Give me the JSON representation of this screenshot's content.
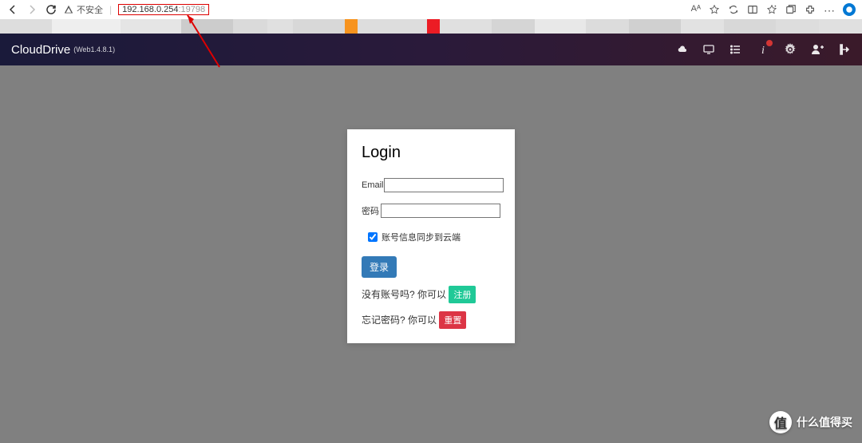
{
  "browser": {
    "insecure_label": "不安全",
    "url_ip": "192.168.0.254",
    "url_port": ":19798",
    "ai_label": "Aᴬ"
  },
  "color_strip": [
    {
      "w": "6%",
      "c": "#ddd"
    },
    {
      "w": "8%",
      "c": "#eee"
    },
    {
      "w": "7%",
      "c": "#e5e5e5"
    },
    {
      "w": "6%",
      "c": "#ccc"
    },
    {
      "w": "4%",
      "c": "#dadada"
    },
    {
      "w": "3%",
      "c": "#e0e0e0"
    },
    {
      "w": "6%",
      "c": "#d8d8d8"
    },
    {
      "w": "1.5%",
      "c": "#f7931e"
    },
    {
      "w": "8%",
      "c": "#ddd"
    },
    {
      "w": "1.5%",
      "c": "#ec1c24"
    },
    {
      "w": "6%",
      "c": "#e0e0e0"
    },
    {
      "w": "5%",
      "c": "#d5d5d5"
    },
    {
      "w": "6%",
      "c": "#e8e8e8"
    },
    {
      "w": "5%",
      "c": "#dcdcdc"
    },
    {
      "w": "6%",
      "c": "#d0d0d0"
    },
    {
      "w": "5%",
      "c": "#e2e2e2"
    },
    {
      "w": "6%",
      "c": "#d8d8d8"
    },
    {
      "w": "5%",
      "c": "#ddd"
    },
    {
      "w": "5%",
      "c": "#e0e0e0"
    }
  ],
  "app": {
    "title": "CloudDrive",
    "version": "(Web1.4.8.1)"
  },
  "login": {
    "title": "Login",
    "email_label": "Email",
    "password_label": "密码",
    "sync_label": "账号信息同步到云端",
    "login_btn": "登录",
    "no_account_text": "没有账号吗? 你可以 ",
    "register_btn": "注册",
    "forgot_text": "忘记密码? 你可以 ",
    "reset_btn": "重置"
  },
  "watermark": {
    "badge": "值",
    "text": "什么值得买"
  }
}
